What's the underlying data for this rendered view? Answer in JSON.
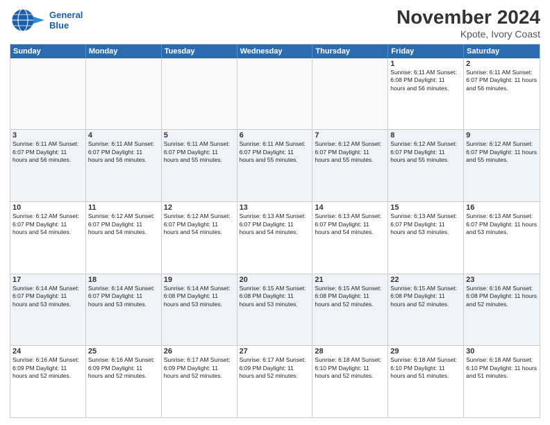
{
  "header": {
    "logo_general": "General",
    "logo_blue": "Blue",
    "title": "November 2024",
    "subtitle": "Kpote, Ivory Coast"
  },
  "days_of_week": [
    "Sunday",
    "Monday",
    "Tuesday",
    "Wednesday",
    "Thursday",
    "Friday",
    "Saturday"
  ],
  "weeks": [
    [
      {
        "day": "",
        "info": "",
        "empty": true
      },
      {
        "day": "",
        "info": "",
        "empty": true
      },
      {
        "day": "",
        "info": "",
        "empty": true
      },
      {
        "day": "",
        "info": "",
        "empty": true
      },
      {
        "day": "",
        "info": "",
        "empty": true
      },
      {
        "day": "1",
        "info": "Sunrise: 6:11 AM\nSunset: 6:08 PM\nDaylight: 11 hours\nand 56 minutes."
      },
      {
        "day": "2",
        "info": "Sunrise: 6:11 AM\nSunset: 6:07 PM\nDaylight: 11 hours\nand 56 minutes."
      }
    ],
    [
      {
        "day": "3",
        "info": "Sunrise: 6:11 AM\nSunset: 6:07 PM\nDaylight: 11 hours\nand 56 minutes."
      },
      {
        "day": "4",
        "info": "Sunrise: 6:11 AM\nSunset: 6:07 PM\nDaylight: 11 hours\nand 56 minutes."
      },
      {
        "day": "5",
        "info": "Sunrise: 6:11 AM\nSunset: 6:07 PM\nDaylight: 11 hours\nand 55 minutes."
      },
      {
        "day": "6",
        "info": "Sunrise: 6:11 AM\nSunset: 6:07 PM\nDaylight: 11 hours\nand 55 minutes."
      },
      {
        "day": "7",
        "info": "Sunrise: 6:12 AM\nSunset: 6:07 PM\nDaylight: 11 hours\nand 55 minutes."
      },
      {
        "day": "8",
        "info": "Sunrise: 6:12 AM\nSunset: 6:07 PM\nDaylight: 11 hours\nand 55 minutes."
      },
      {
        "day": "9",
        "info": "Sunrise: 6:12 AM\nSunset: 6:07 PM\nDaylight: 11 hours\nand 55 minutes."
      }
    ],
    [
      {
        "day": "10",
        "info": "Sunrise: 6:12 AM\nSunset: 6:07 PM\nDaylight: 11 hours\nand 54 minutes."
      },
      {
        "day": "11",
        "info": "Sunrise: 6:12 AM\nSunset: 6:07 PM\nDaylight: 11 hours\nand 54 minutes."
      },
      {
        "day": "12",
        "info": "Sunrise: 6:12 AM\nSunset: 6:07 PM\nDaylight: 11 hours\nand 54 minutes."
      },
      {
        "day": "13",
        "info": "Sunrise: 6:13 AM\nSunset: 6:07 PM\nDaylight: 11 hours\nand 54 minutes."
      },
      {
        "day": "14",
        "info": "Sunrise: 6:13 AM\nSunset: 6:07 PM\nDaylight: 11 hours\nand 54 minutes."
      },
      {
        "day": "15",
        "info": "Sunrise: 6:13 AM\nSunset: 6:07 PM\nDaylight: 11 hours\nand 53 minutes."
      },
      {
        "day": "16",
        "info": "Sunrise: 6:13 AM\nSunset: 6:07 PM\nDaylight: 11 hours\nand 53 minutes."
      }
    ],
    [
      {
        "day": "17",
        "info": "Sunrise: 6:14 AM\nSunset: 6:07 PM\nDaylight: 11 hours\nand 53 minutes."
      },
      {
        "day": "18",
        "info": "Sunrise: 6:14 AM\nSunset: 6:07 PM\nDaylight: 11 hours\nand 53 minutes."
      },
      {
        "day": "19",
        "info": "Sunrise: 6:14 AM\nSunset: 6:08 PM\nDaylight: 11 hours\nand 53 minutes."
      },
      {
        "day": "20",
        "info": "Sunrise: 6:15 AM\nSunset: 6:08 PM\nDaylight: 11 hours\nand 53 minutes."
      },
      {
        "day": "21",
        "info": "Sunrise: 6:15 AM\nSunset: 6:08 PM\nDaylight: 11 hours\nand 52 minutes."
      },
      {
        "day": "22",
        "info": "Sunrise: 6:15 AM\nSunset: 6:08 PM\nDaylight: 11 hours\nand 52 minutes."
      },
      {
        "day": "23",
        "info": "Sunrise: 6:16 AM\nSunset: 6:08 PM\nDaylight: 11 hours\nand 52 minutes."
      }
    ],
    [
      {
        "day": "24",
        "info": "Sunrise: 6:16 AM\nSunset: 6:09 PM\nDaylight: 11 hours\nand 52 minutes."
      },
      {
        "day": "25",
        "info": "Sunrise: 6:16 AM\nSunset: 6:09 PM\nDaylight: 11 hours\nand 52 minutes."
      },
      {
        "day": "26",
        "info": "Sunrise: 6:17 AM\nSunset: 6:09 PM\nDaylight: 11 hours\nand 52 minutes."
      },
      {
        "day": "27",
        "info": "Sunrise: 6:17 AM\nSunset: 6:09 PM\nDaylight: 11 hours\nand 52 minutes."
      },
      {
        "day": "28",
        "info": "Sunrise: 6:18 AM\nSunset: 6:10 PM\nDaylight: 11 hours\nand 52 minutes."
      },
      {
        "day": "29",
        "info": "Sunrise: 6:18 AM\nSunset: 6:10 PM\nDaylight: 11 hours\nand 51 minutes."
      },
      {
        "day": "30",
        "info": "Sunrise: 6:18 AM\nSunset: 6:10 PM\nDaylight: 11 hours\nand 51 minutes."
      }
    ]
  ]
}
